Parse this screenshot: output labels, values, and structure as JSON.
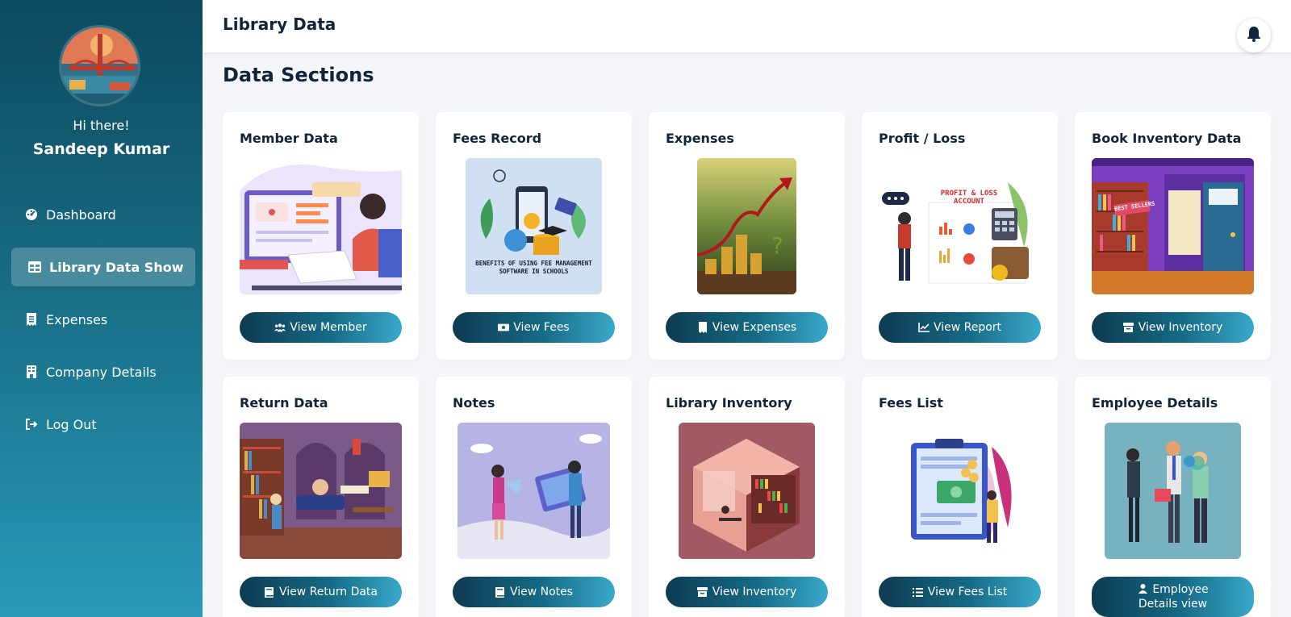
{
  "sidebar": {
    "greeting": "Hi there!",
    "username": "Sandeep Kumar",
    "items": [
      {
        "label": "Dashboard",
        "icon": "dashboard-icon",
        "active": false
      },
      {
        "label": "Library Data Show",
        "icon": "table-icon",
        "active": true
      },
      {
        "label": "Expenses",
        "icon": "receipt-icon",
        "active": false
      },
      {
        "label": "Company Details",
        "icon": "building-icon",
        "active": false
      },
      {
        "label": "Log Out",
        "icon": "logout-icon",
        "active": false
      }
    ]
  },
  "header": {
    "title": "Library Data",
    "notification_icon": "bell-icon"
  },
  "main": {
    "section_title": "Data Sections",
    "cards": [
      {
        "title": "Member Data",
        "button": "View Member",
        "button_icon": "users-icon"
      },
      {
        "title": "Fees Record",
        "button": "View Fees",
        "button_icon": "money-icon",
        "image_caption": "BENEFITS OF USING FEE MANAGEMENT SOFTWARE IN SCHOOLS"
      },
      {
        "title": "Expenses",
        "button": "View Expenses",
        "button_icon": "receipt-icon"
      },
      {
        "title": "Profit / Loss",
        "button": "View Report",
        "button_icon": "chart-line-icon",
        "image_caption": "PROFIT & LOSS ACCOUNT"
      },
      {
        "title": "Book Inventory Data",
        "button": "View Inventory",
        "button_icon": "box-icon",
        "image_caption": "BEST SELLERS"
      },
      {
        "title": "Return Data",
        "button": "View Return Data",
        "button_icon": "book-icon"
      },
      {
        "title": "Notes",
        "button": "View Notes",
        "button_icon": "book-icon"
      },
      {
        "title": "Library Inventory",
        "button": "View Inventory",
        "button_icon": "box-icon"
      },
      {
        "title": "Fees List",
        "button": "View Fees List",
        "button_icon": "list-icon"
      },
      {
        "title": "Employee Details",
        "button": "Employee Details view",
        "button_icon": "user-icon"
      }
    ]
  },
  "colors": {
    "sidebar_top": "#0d4a5f",
    "sidebar_bottom": "#2a9ab8",
    "button_start": "#0d3b52",
    "button_end": "#39a8c9",
    "page_bg": "#f4f6f9"
  }
}
